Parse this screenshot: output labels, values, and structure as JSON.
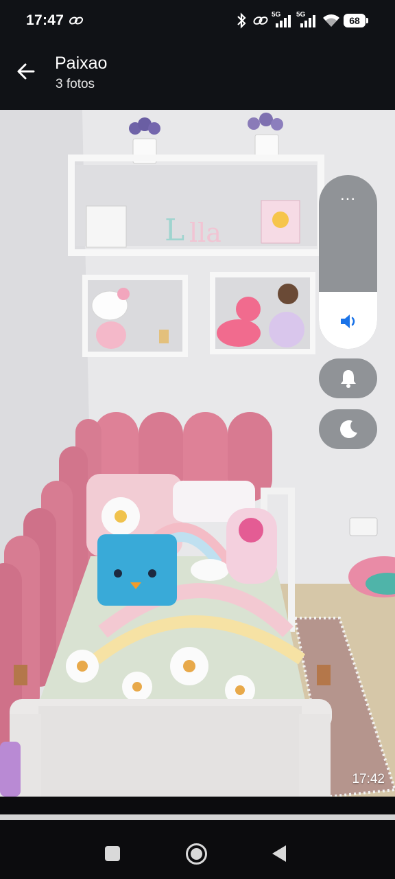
{
  "status_bar": {
    "time": "17:47",
    "network_label_1": "5G",
    "network_label_2": "5G",
    "battery": "68",
    "icons": [
      "link-icon",
      "bluetooth-icon",
      "hotspot-icon",
      "signal-icon",
      "wifi-icon",
      "battery-icon"
    ]
  },
  "header": {
    "title": "Paixao",
    "subtitle": "3 fotos",
    "back_icon": "arrow-left-icon"
  },
  "photo": {
    "timestamp": "17:42"
  },
  "volume_panel": {
    "more_label": "...",
    "level": 0.33,
    "icons": [
      "speaker-icon",
      "bell-icon",
      "moon-icon"
    ],
    "accent": "#1a73e8"
  },
  "nav_bar": {
    "icons": [
      "recents-icon",
      "home-icon",
      "back-icon"
    ]
  }
}
